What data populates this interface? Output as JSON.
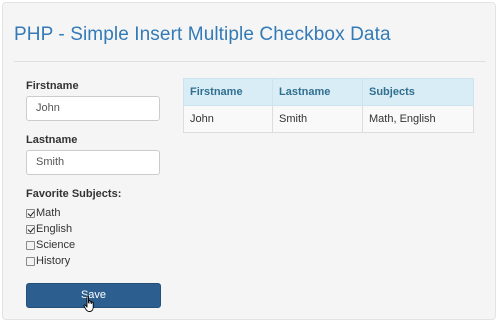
{
  "page": {
    "title": "PHP - Simple Insert Multiple Checkbox Data"
  },
  "form": {
    "firstname_label": "Firstname",
    "firstname_value": "John",
    "lastname_label": "Lastname",
    "lastname_value": "Smith",
    "subjects_label": "Favorite Subjects:",
    "subjects": [
      {
        "label": "Math",
        "checked": true
      },
      {
        "label": "English",
        "checked": true
      },
      {
        "label": "Science",
        "checked": false
      },
      {
        "label": "History",
        "checked": false
      }
    ],
    "save_label": "Save"
  },
  "table": {
    "headers": [
      "Firstname",
      "Lastname",
      "Subjects"
    ],
    "rows": [
      [
        "John",
        "Smith",
        "Math, English"
      ]
    ]
  },
  "colors": {
    "title": "#337ab7",
    "button": "#2c5f8f",
    "table_header_bg": "#d9edf7",
    "table_header_text": "#31708f"
  }
}
